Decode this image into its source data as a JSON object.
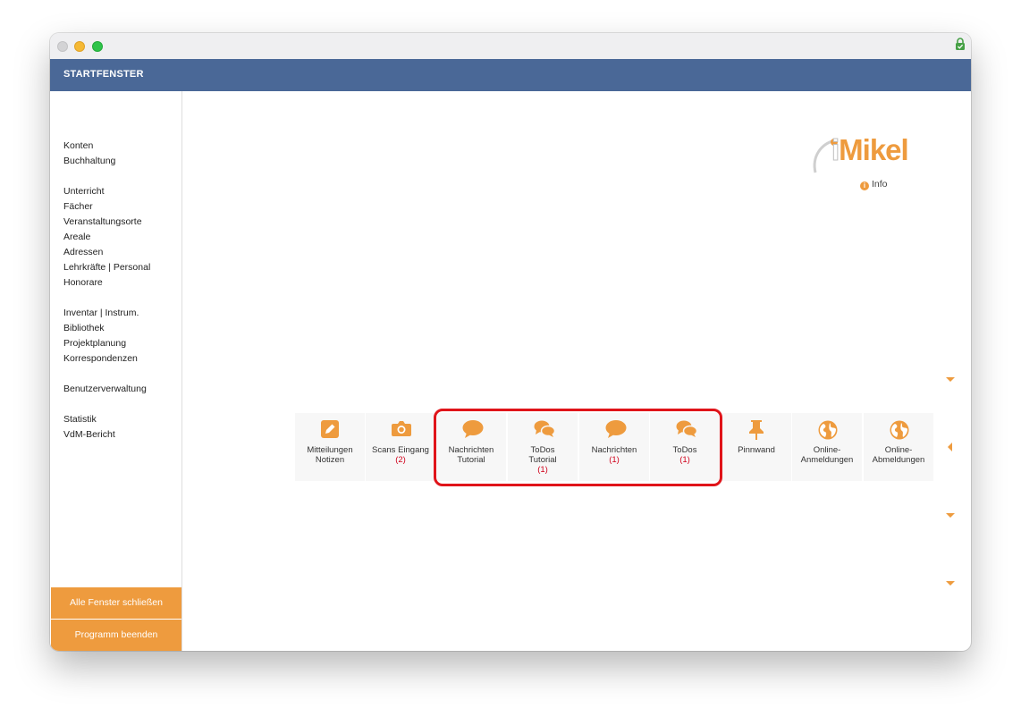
{
  "header": {
    "title": "STARTFENSTER"
  },
  "sidebar": {
    "groups": [
      [
        "Konten",
        "Buchhaltung"
      ],
      [
        "Unterricht",
        "Fächer",
        "Veranstaltungsorte",
        "Areale",
        "Adressen",
        "Lehrkräfte | Personal",
        "Honorare"
      ],
      [
        "Inventar | Instrum.",
        "Bibliothek",
        "Projektplanung",
        "Korrespondenzen"
      ],
      [
        "Benutzerverwaltung"
      ],
      [
        "Statistik",
        "VdM-Bericht"
      ]
    ],
    "close_all_label": "Alle Fenster schließen",
    "quit_label": "Programm beenden"
  },
  "logo": {
    "prefix": "i",
    "rest": "Mikel"
  },
  "info_label": "Info",
  "tiles": [
    {
      "line1": "Mitteilungen",
      "line2": "Notizen",
      "count": "",
      "icon": "pencil-square-icon"
    },
    {
      "line1": "Scans Eingang",
      "line2": "",
      "count": "(2)",
      "icon": "camera-icon"
    },
    {
      "line1": "Nachrichten",
      "line2": "Tutorial",
      "count": "",
      "icon": "speech-bubble-icon"
    },
    {
      "line1": "ToDos",
      "line2": "Tutorial",
      "count": "(1)",
      "icon": "speech-bubbles-icon"
    },
    {
      "line1": "Nachrichten",
      "line2": "",
      "count": "(1)",
      "icon": "speech-bubble-icon"
    },
    {
      "line1": "ToDos",
      "line2": "",
      "count": "(1)",
      "icon": "speech-bubbles-icon"
    },
    {
      "line1": "Pinnwand",
      "line2": "",
      "count": "",
      "icon": "pushpin-icon"
    },
    {
      "line1": "Online-",
      "line2": "Anmeldungen",
      "count": "",
      "icon": "globe-icon"
    },
    {
      "line1": "Online-",
      "line2": "Abmeldungen",
      "count": "",
      "icon": "globe-icon"
    }
  ],
  "colors": {
    "accent": "#ee9b3e",
    "header": "#4a6897",
    "count": "#d0021b",
    "highlight": "#e0141a"
  }
}
